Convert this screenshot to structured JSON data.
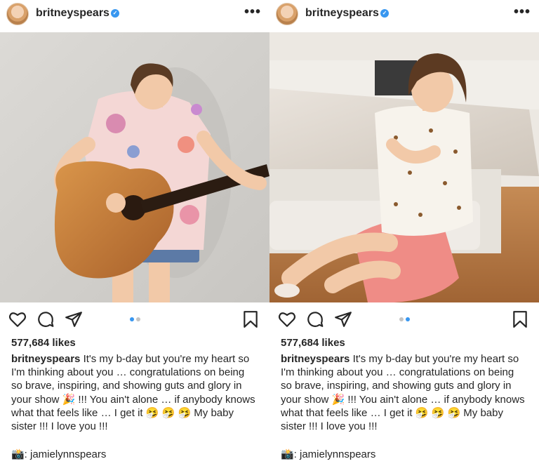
{
  "posts": [
    {
      "username": "britneyspears",
      "verified_mark": "✓",
      "more_label": "•••",
      "likes": "577,684 likes",
      "caption_user": "britneyspears",
      "caption_text": "It's my b-day but you're my heart so I'm thinking about you … congratulations on being so brave, inspiring, and showing guts and glory in your show 🎉 !!! You ain't alone … if anybody knows what that feels like … I get it 🤧 🤧 🤧  My baby sister !!! I love you !!!",
      "credit": "📸: jamielynnspears",
      "active_slide": 1
    },
    {
      "username": "britneyspears",
      "verified_mark": "✓",
      "more_label": "•••",
      "likes": "577,684 likes",
      "caption_user": "britneyspears",
      "caption_text": "It's my b-day but you're my heart so I'm thinking about you … congratulations on being so brave, inspiring, and showing guts and glory in your show 🎉 !!! You ain't alone … if anybody knows what that feels like … I get it 🤧 🤧 🤧  My baby sister !!! I love you !!!",
      "credit": "📸: jamielynnspears",
      "active_slide": 2
    }
  ],
  "icons": [
    "heart-icon",
    "comment-icon",
    "share-icon",
    "bookmark-icon",
    "verified-icon",
    "more-icon"
  ],
  "colors": {
    "verified": "#3897f0",
    "dot_active": "#3897f0",
    "dot_inactive": "#c4c4c4",
    "text": "#262626"
  }
}
